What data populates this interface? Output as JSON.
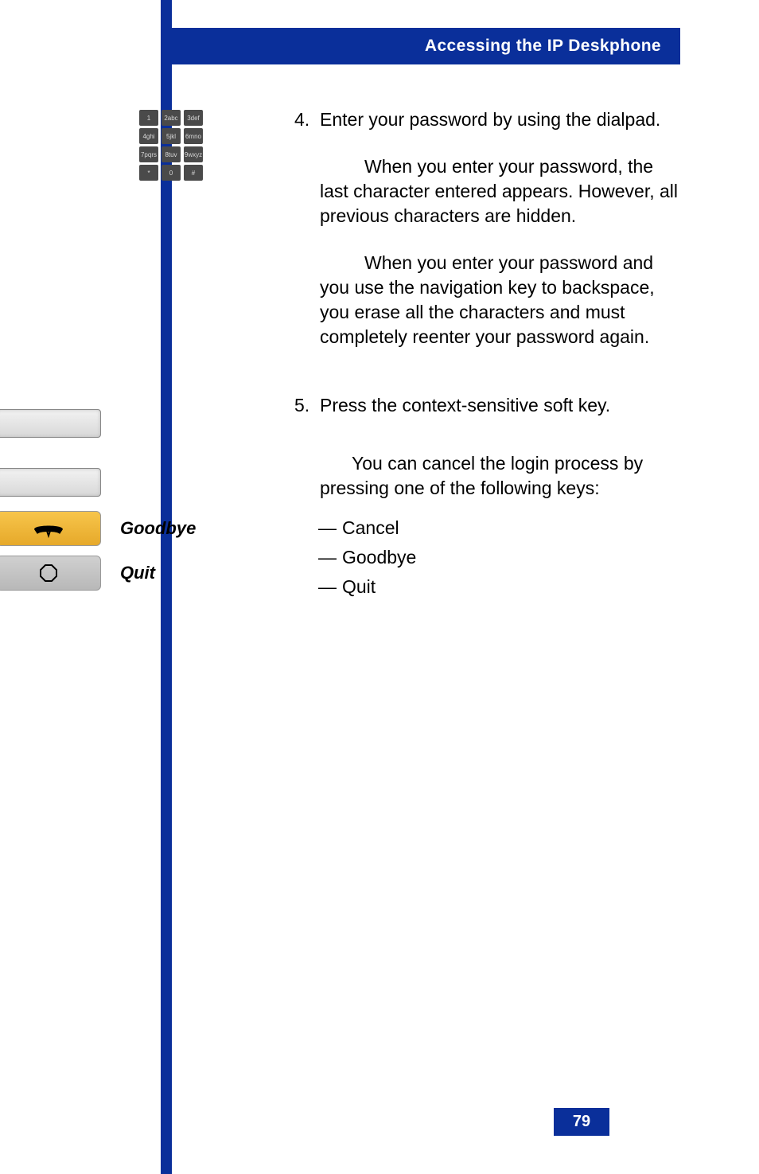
{
  "header": {
    "title": "Accessing the IP Deskphone"
  },
  "dialpad": {
    "rows": [
      {
        "k1": "1",
        "k2": "2abc",
        "k3": "3def"
      },
      {
        "k1": "4ghi",
        "k2": "5jkl",
        "k3": "6mno"
      },
      {
        "k1": "7pqrs",
        "k2": "8tuv",
        "k3": "9wxyz"
      },
      {
        "k1": "*",
        "k2": "0",
        "k3": "#"
      }
    ]
  },
  "step4": {
    "number": "4.",
    "line1": "Enter your password by using the dialpad.",
    "para1": "When you enter your password, the last character entered appears. However, all previous characters are hidden.",
    "para2": "When you enter your password and you use the navigation key to backspace, you erase all the characters and must completely reenter your password again."
  },
  "step5": {
    "number": "5.",
    "line1a": "Press the ",
    "line1b": " context-sensitive soft key.",
    "para1": "You can cancel the login process by pressing one of the following keys:",
    "items": {
      "dash1": "—",
      "item1": "Cancel",
      "dash2": "—",
      "item2": "Goodbye",
      "dash3": "—",
      "item3": "Quit"
    }
  },
  "buttons": {
    "goodbye_label": "Goodbye",
    "quit_label": "Quit"
  },
  "page_number": "79"
}
